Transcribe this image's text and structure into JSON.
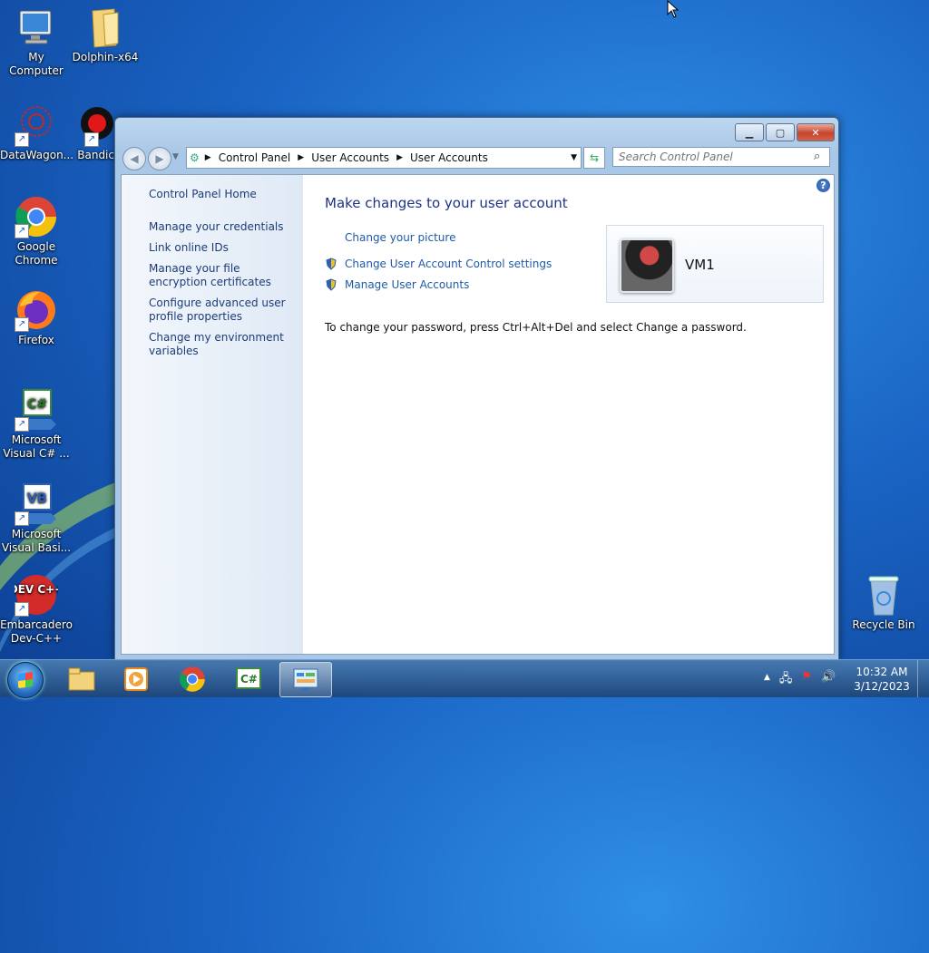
{
  "desktop": {
    "icons": [
      {
        "label": "My Computer",
        "icon": "computer-icon"
      },
      {
        "label": "Dolphin-x64",
        "icon": "folder-icon"
      },
      {
        "label": "DataWagon...",
        "icon": "datawagon-icon"
      },
      {
        "label": "Bandic",
        "icon": "bandicam-icon"
      },
      {
        "label": "Google Chrome",
        "icon": "chrome-icon"
      },
      {
        "label": "Firefox",
        "icon": "firefox-icon"
      },
      {
        "label": "Microsoft Visual C# ...",
        "icon": "visual-csharp-icon",
        "glyph": "C#"
      },
      {
        "label": "Microsoft Visual Basi...",
        "icon": "visual-basic-icon",
        "glyph": "VB"
      },
      {
        "label": "Embarcadero Dev-C++",
        "icon": "devcpp-icon",
        "glyph": "DEV C++"
      },
      {
        "label": "Recycle Bin",
        "icon": "recycle-bin-icon"
      }
    ]
  },
  "window": {
    "address": {
      "crumbs": [
        "Control Panel",
        "User Accounts",
        "User Accounts"
      ]
    },
    "search": {
      "placeholder": "Search Control Panel"
    },
    "left_pane": {
      "links": [
        "Control Panel Home",
        "Manage your credentials",
        "Link online IDs",
        "Manage your file encryption certificates",
        "Configure advanced user profile properties",
        "Change my environment variables"
      ]
    },
    "main": {
      "heading": "Make changes to your user account",
      "links": [
        {
          "label": "Change your picture",
          "shield": false
        },
        {
          "label": "Change User Account Control settings",
          "shield": true
        },
        {
          "label": "Manage User Accounts",
          "shield": true
        }
      ],
      "note": "To change your password, press Ctrl+Alt+Del and select Change a password.",
      "account_name": "VM1"
    },
    "help_label": "?"
  },
  "taskbar": {
    "clock_time": "10:32 AM",
    "clock_date": "3/12/2023",
    "tray_arrow": "▲"
  },
  "colors": {
    "accent": "#1e3287",
    "link": "#1e5aa8"
  }
}
